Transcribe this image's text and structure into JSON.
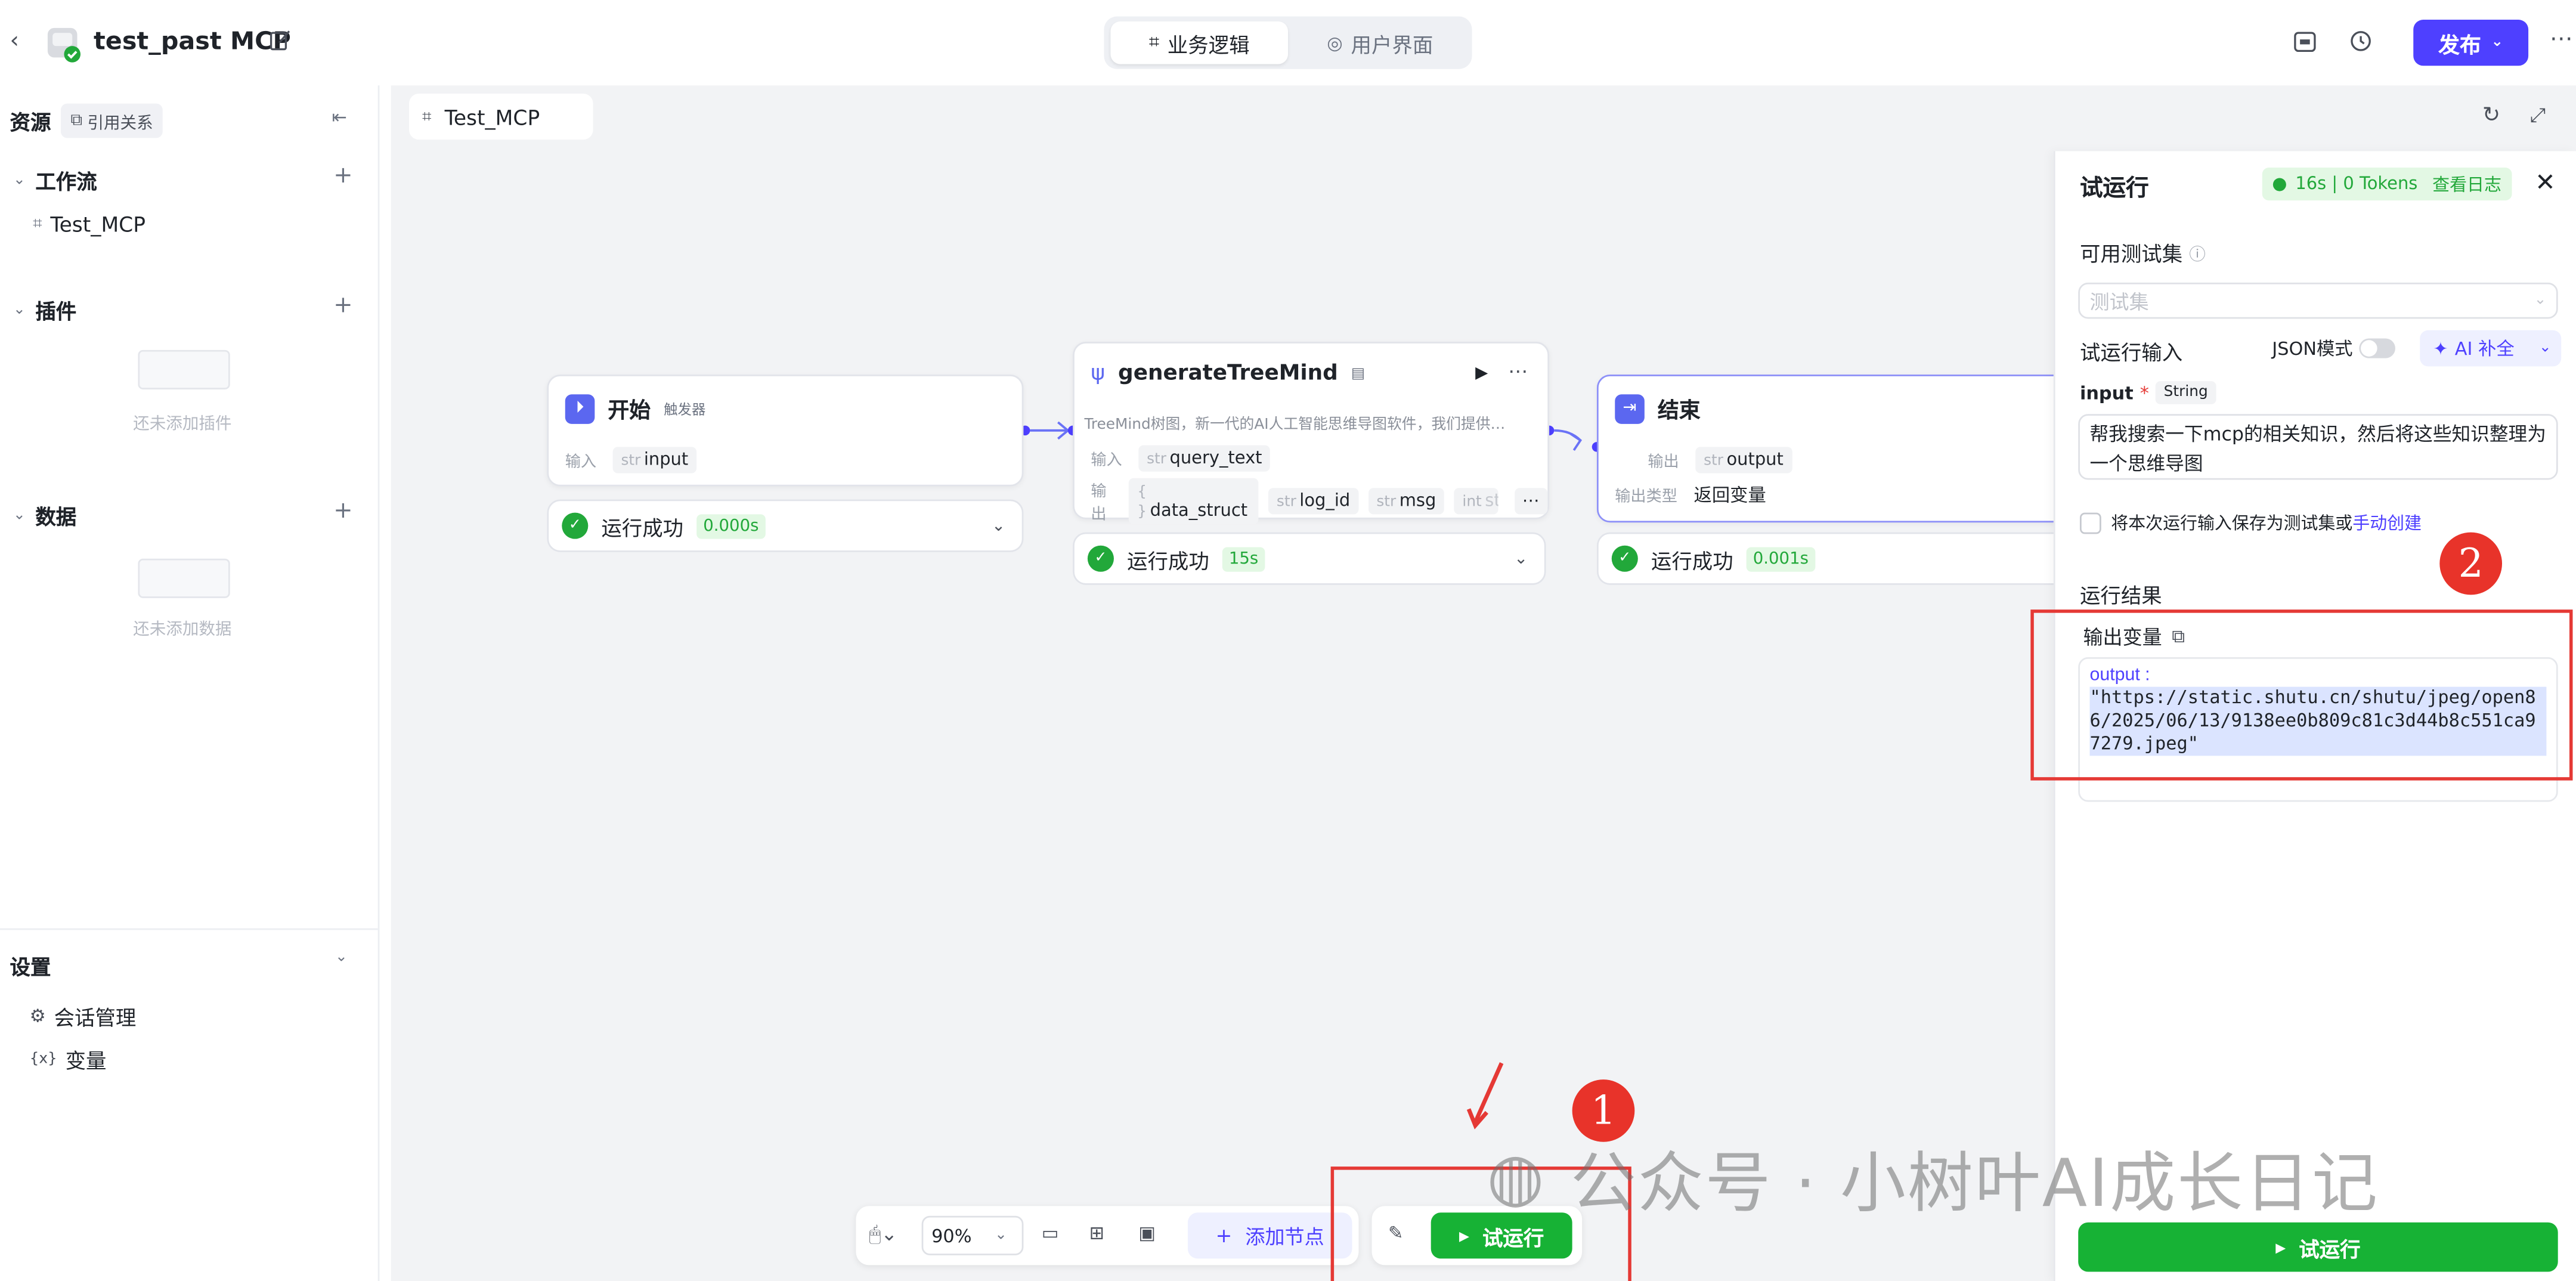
{
  "header": {
    "app_title": "test_past MCP",
    "tabs": [
      {
        "label": "业务逻辑",
        "active": true
      },
      {
        "label": "用户界面",
        "active": false
      }
    ],
    "publish_label": "发布"
  },
  "sidebar": {
    "resources_label": "资源",
    "refs_label": "引用关系",
    "workflow_section": "工作流",
    "workflow_items": [
      "Test_MCP"
    ],
    "plugin_section": "插件",
    "plugin_empty": "还未添加插件",
    "data_section": "数据",
    "data_empty": "还未添加数据",
    "settings_section": "设置",
    "settings_items": [
      "会话管理",
      "变量"
    ]
  },
  "canvas": {
    "file_tab": "Test_MCP",
    "nodes": {
      "start": {
        "title": "开始",
        "badge": "触发器",
        "input_label": "输入",
        "input_var_type": "str",
        "input_var": "input",
        "status": "运行成功",
        "time": "0.000s"
      },
      "tree": {
        "title": "generateTreeMind",
        "desc": "TreeMind树图，新一代的AI人工智能思维导图软件，我们提供…",
        "input_label": "输入",
        "input_var_type": "str",
        "input_var": "query_text",
        "output_label": "输出",
        "outputs": [
          {
            "type": "{ }",
            "name": "data_struct"
          },
          {
            "type": "str",
            "name": "log_id"
          },
          {
            "type": "str",
            "name": "msg"
          },
          {
            "type": "int",
            "name": "sta"
          }
        ],
        "status": "运行成功",
        "time": "15s"
      },
      "end": {
        "title": "结束",
        "output_label": "输出",
        "output_var_type": "str",
        "output_var": "output",
        "output_type_label": "输出类型",
        "output_type_value": "返回变量",
        "status": "运行成功",
        "time": "0.001s"
      }
    }
  },
  "toolbar": {
    "zoom": "90%",
    "add_node_label": "添加节点",
    "run_label": "试运行"
  },
  "panel": {
    "title": "试运行",
    "summary": "16s | 0 Tokens",
    "view_log": "查看日志",
    "test_set_label": "可用测试集",
    "test_set_placeholder": "测试集",
    "run_input_label": "试运行输入",
    "json_mode_label": "JSON模式",
    "ai_fill_label": "AI 补全",
    "input_name": "input",
    "input_required": "*",
    "input_type": "String",
    "input_value": "帮我搜索一下mcp的相关知识，然后将这些知识整理为一个思维导图",
    "save_checkbox_label": "将本次运行输入保存为测试集或",
    "manual_create": "手动创建",
    "result_label": "运行结果",
    "output_var_label": "输出变量",
    "output_key": "output :",
    "output_value": "\"https://static.shutu.cn/shutu/jpeg/open86/2025/06/13/9138ee0b809c81c3d44b8c551ca97279.jpeg\"",
    "run_button": "试运行"
  },
  "annotations": {
    "badge_1": "1",
    "badge_2": "2",
    "watermark": "公众号 · 小树叶AI成长日记"
  },
  "colors": {
    "accent": "#4e40ff",
    "success": "#17b235",
    "annotation_red": "#e53935"
  }
}
